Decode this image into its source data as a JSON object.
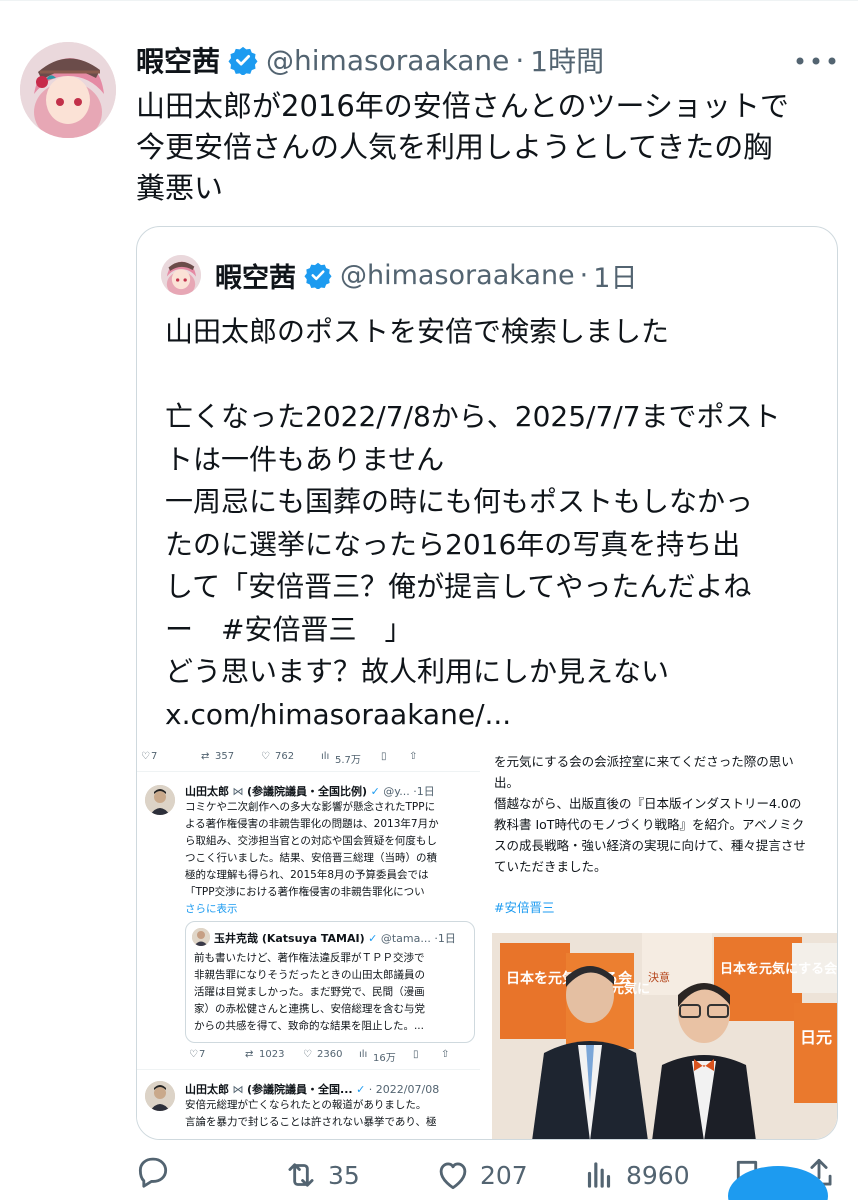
{
  "tweet": {
    "author_name": "暇空茜",
    "handle": "@himasoraakane",
    "dot": "·",
    "time": "1時間",
    "text": "山田太郎が2016年の安倍さんとのツーショットで\n今更安倍さんの人気を利用しようとしてきたの胸\n糞悪い"
  },
  "quote": {
    "author_name": "暇空茜",
    "handle": "@himasoraakane",
    "dot": "·",
    "time": "1日",
    "text": "山田太郎のポストを安倍で検索しました\n\n亡くなった2022/7/8から、2025/7/7までポスト\nトは一件もありません\n一周忌にも国葬の時にも何もポストもしなかっ\nたのに選挙になったら2016年の写真を持ち出\nして「安倍晋三？俺が提言してやったんだよね\nー　#安倍晋三　」\nどう思います？故人利用にしか見えない\nx.com/himasoraakane/..."
  },
  "media_left": {
    "top_stats": [
      "7",
      "357",
      "762",
      "5.7万"
    ],
    "post1": {
      "name": "山田太郎",
      "meta": "(参議院議員・全国比例)",
      "handle": "@y...",
      "time": "·1日",
      "body": "コミケや二次創作への多大な影響が懸念されたTPPに\nよる著作権侵害の非親告罪化の問題は、2013年7月か\nら取組み、交渉担当官との対応や国会質疑を何度もし\nつこく行いました。結果、安倍晋三総理（当時）の積\n極的な理解も得られ、2015年8月の予算委員会では\n「TPP交渉における著作権侵害の非親告罪化につい",
      "more": "さらに表示"
    },
    "nested": {
      "name": "玉井克哉 (Katsuya TAMAI)",
      "handle": "@tama...",
      "time": "·1日",
      "body": "前も書いたけど、著作権法違反罪がＴＰＰ交渉で\n非親告罪になりそうだったときの山田太郎議員の\n活躍は目覚ましかった。まだ野党で、民間（漫画\n家）の赤松健さんと連携し、安倍総理を含む与党\nからの共感を得て、致命的な結果を阻止した。..."
    },
    "mid_stats": [
      "7",
      "1023",
      "2360",
      "16万"
    ],
    "post2": {
      "name": "山田太郎",
      "meta": "(参議院議員・全国...",
      "time": "· 2022/07/08",
      "body": "安倍元総理が亡くなられたとの報道がありました。\n言論を暴力で封じることは許されない暴挙であり、極"
    }
  },
  "media_right": {
    "text": "を元気にする会の会派控室に来てくださった際の思い\n出。\n僭越ながら、出版直後の『日本版インダストリー4.0の\n教科書 IoT時代のモノづくり戦略』を紹介。アベノミク\nスの成長戦略・強い経済の実現に向けて、種々提言させ\nていただきました。",
    "hashtag": "#安倍晋三",
    "sign_text": [
      "日本を元気にする会",
      "日本を元気に",
      "日本を元気にする会",
      "決意",
      "日元"
    ]
  },
  "actions": {
    "reply_count": "",
    "retweet_count": "35",
    "like_count": "207",
    "views_count": "8960"
  },
  "icons": [
    "verified-badge-icon",
    "more-icon",
    "reply-icon",
    "retweet-icon",
    "like-icon",
    "views-icon",
    "bookmark-icon",
    "share-icon"
  ],
  "colors": {
    "verified": "#1d9bf0",
    "text": "#0f1419",
    "secondary": "#536471",
    "border": "#cfd9de",
    "link": "#1d9bf0"
  }
}
